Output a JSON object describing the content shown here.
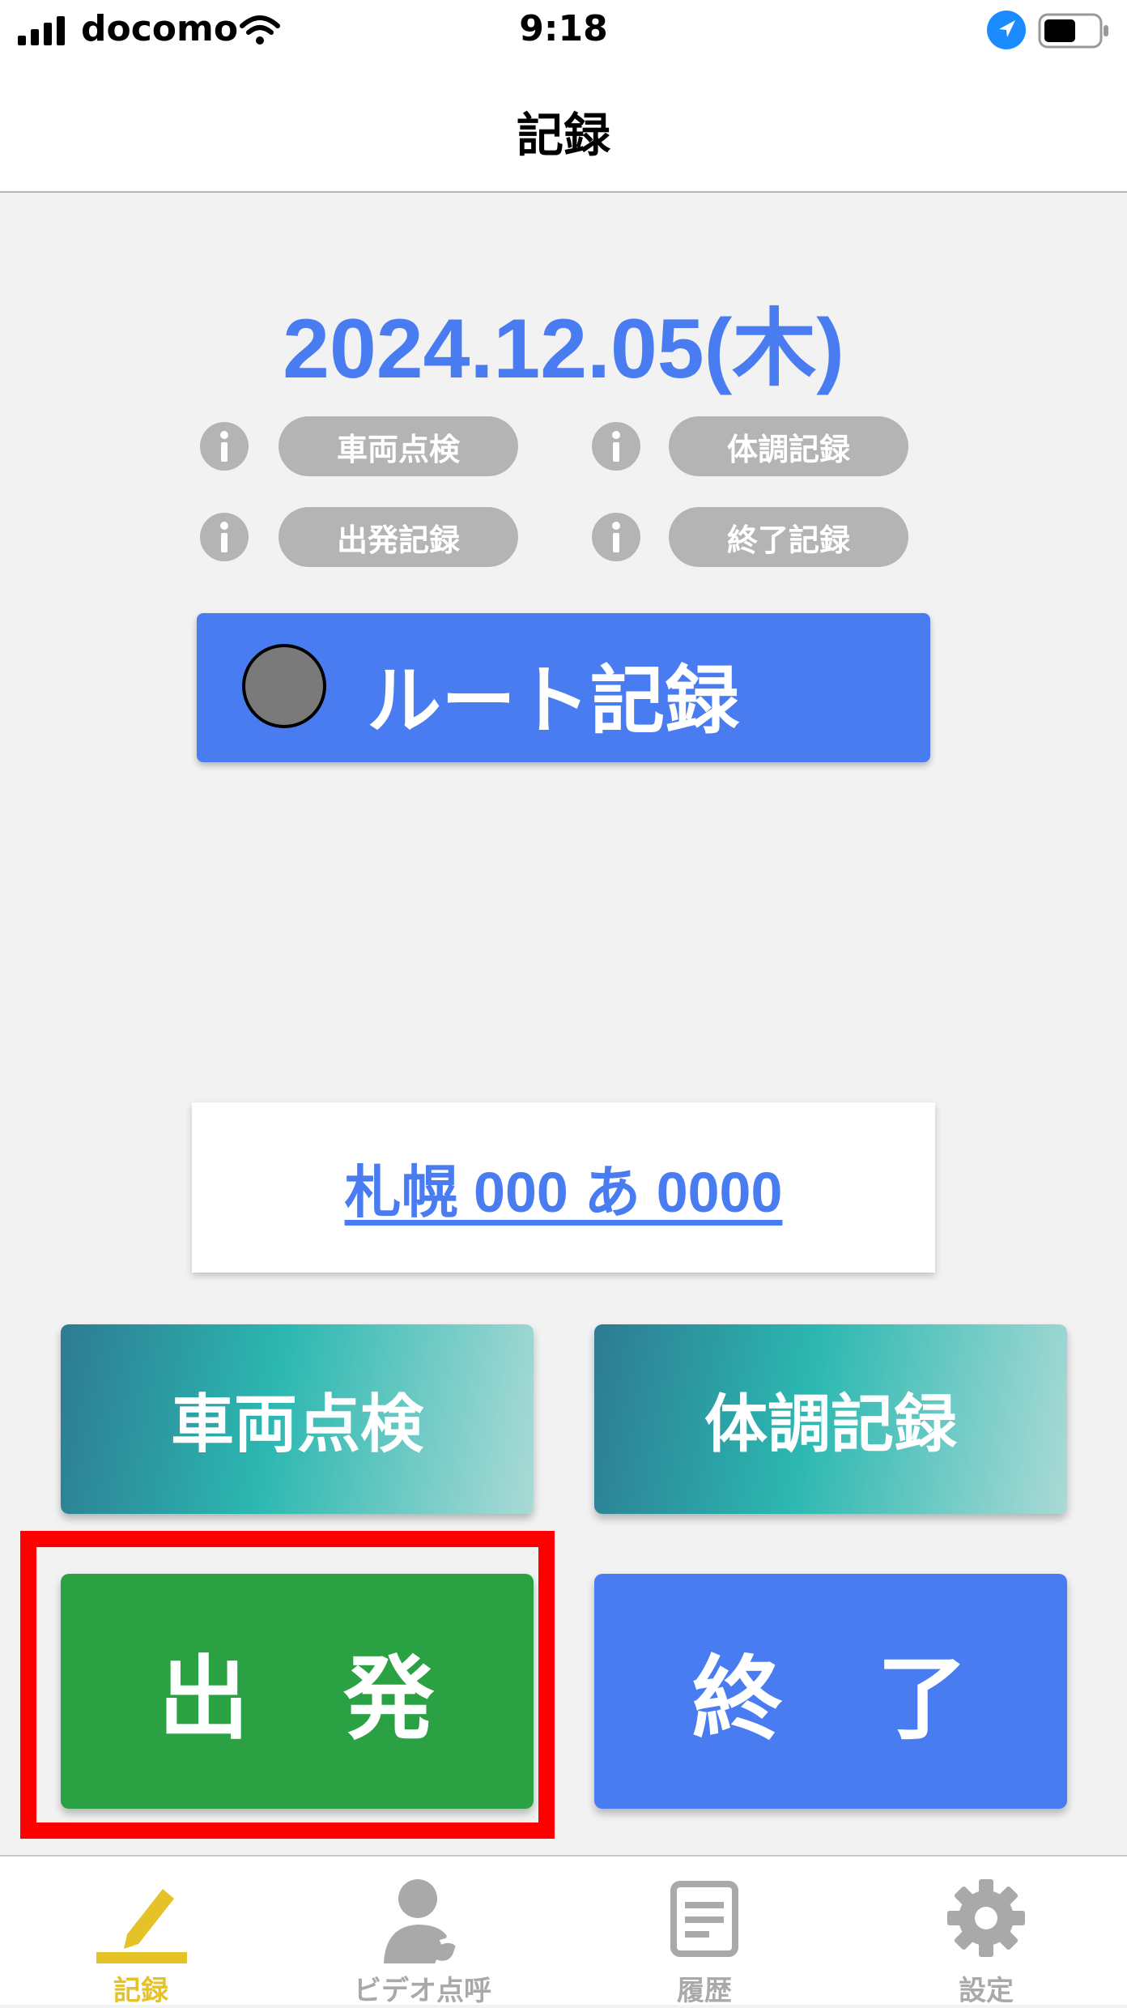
{
  "status_bar": {
    "carrier": "docomo",
    "time": "9:18"
  },
  "nav": {
    "title": "記録"
  },
  "date": "2024.12.05(木)",
  "checklist": [
    {
      "label": "車両点検"
    },
    {
      "label": "体調記録"
    },
    {
      "label": "出発記録"
    },
    {
      "label": "終了記録"
    }
  ],
  "route_button": {
    "label": "ルート記録"
  },
  "vehicle_plate": "札幌 000 あ 0000",
  "actions": {
    "vehicle_inspection": "車両点検",
    "health_record": "体調記録",
    "depart": "出　発",
    "finish": "終　了"
  },
  "tabs": [
    {
      "label": "記録",
      "icon": "pencil-icon",
      "active": true
    },
    {
      "label": "ビデオ点呼",
      "icon": "person-phone-icon",
      "active": false
    },
    {
      "label": "履歴",
      "icon": "document-icon",
      "active": false
    },
    {
      "label": "設定",
      "icon": "gear-icon",
      "active": false
    }
  ],
  "colors": {
    "accent_blue": "#4a7cf1",
    "depart_green": "#2aa143",
    "active_tab": "#e6c229",
    "inactive": "#a9a9a9",
    "highlight_red": "#ff0000"
  }
}
